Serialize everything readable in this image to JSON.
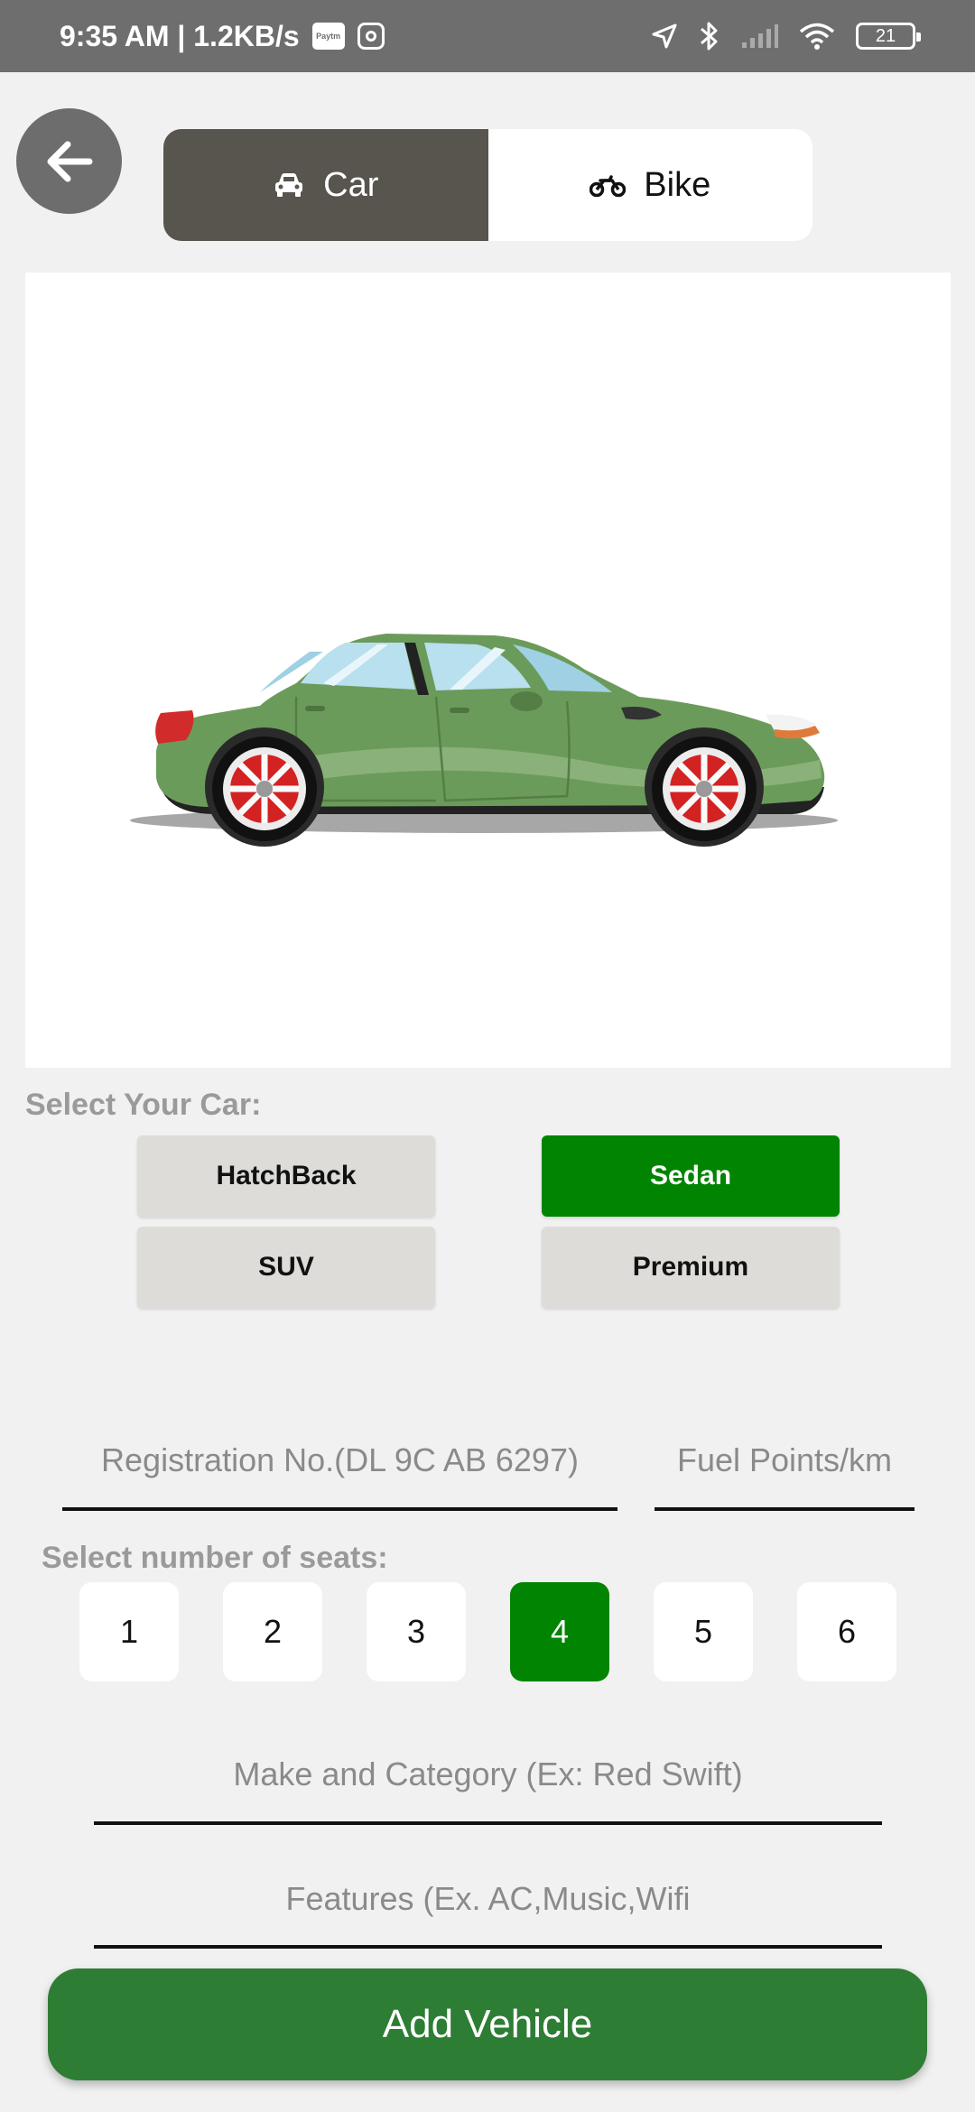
{
  "status_bar": {
    "time_speed": "9:35 AM | 1.2KB/s",
    "paytm_label": "Paytm",
    "battery": "21"
  },
  "toggle": {
    "car_label": "Car",
    "bike_label": "Bike",
    "active": "Car",
    "active_color": "#58544e"
  },
  "select_car_label": "Select Your Car:",
  "car_types": {
    "hatchback": "HatchBack",
    "sedan": "Sedan",
    "suv": "SUV",
    "premium": "Premium",
    "selected": "Sedan",
    "selected_color": "#018401"
  },
  "fields": {
    "registration_placeholder": "Registration No.(DL 9C AB 6297)",
    "fuel_placeholder": "Fuel Points/km",
    "make_placeholder": "Make and Category (Ex: Red Swift)",
    "features_placeholder": "Features (Ex. AC,Music,Wifi"
  },
  "seats_label": "Select number of seats:",
  "seats": [
    "1",
    "2",
    "3",
    "4",
    "5",
    "6"
  ],
  "selected_seat": "4",
  "add_button_label": "Add Vehicle",
  "add_button_color": "#2d7d35",
  "car_color": "#6b9b5a"
}
